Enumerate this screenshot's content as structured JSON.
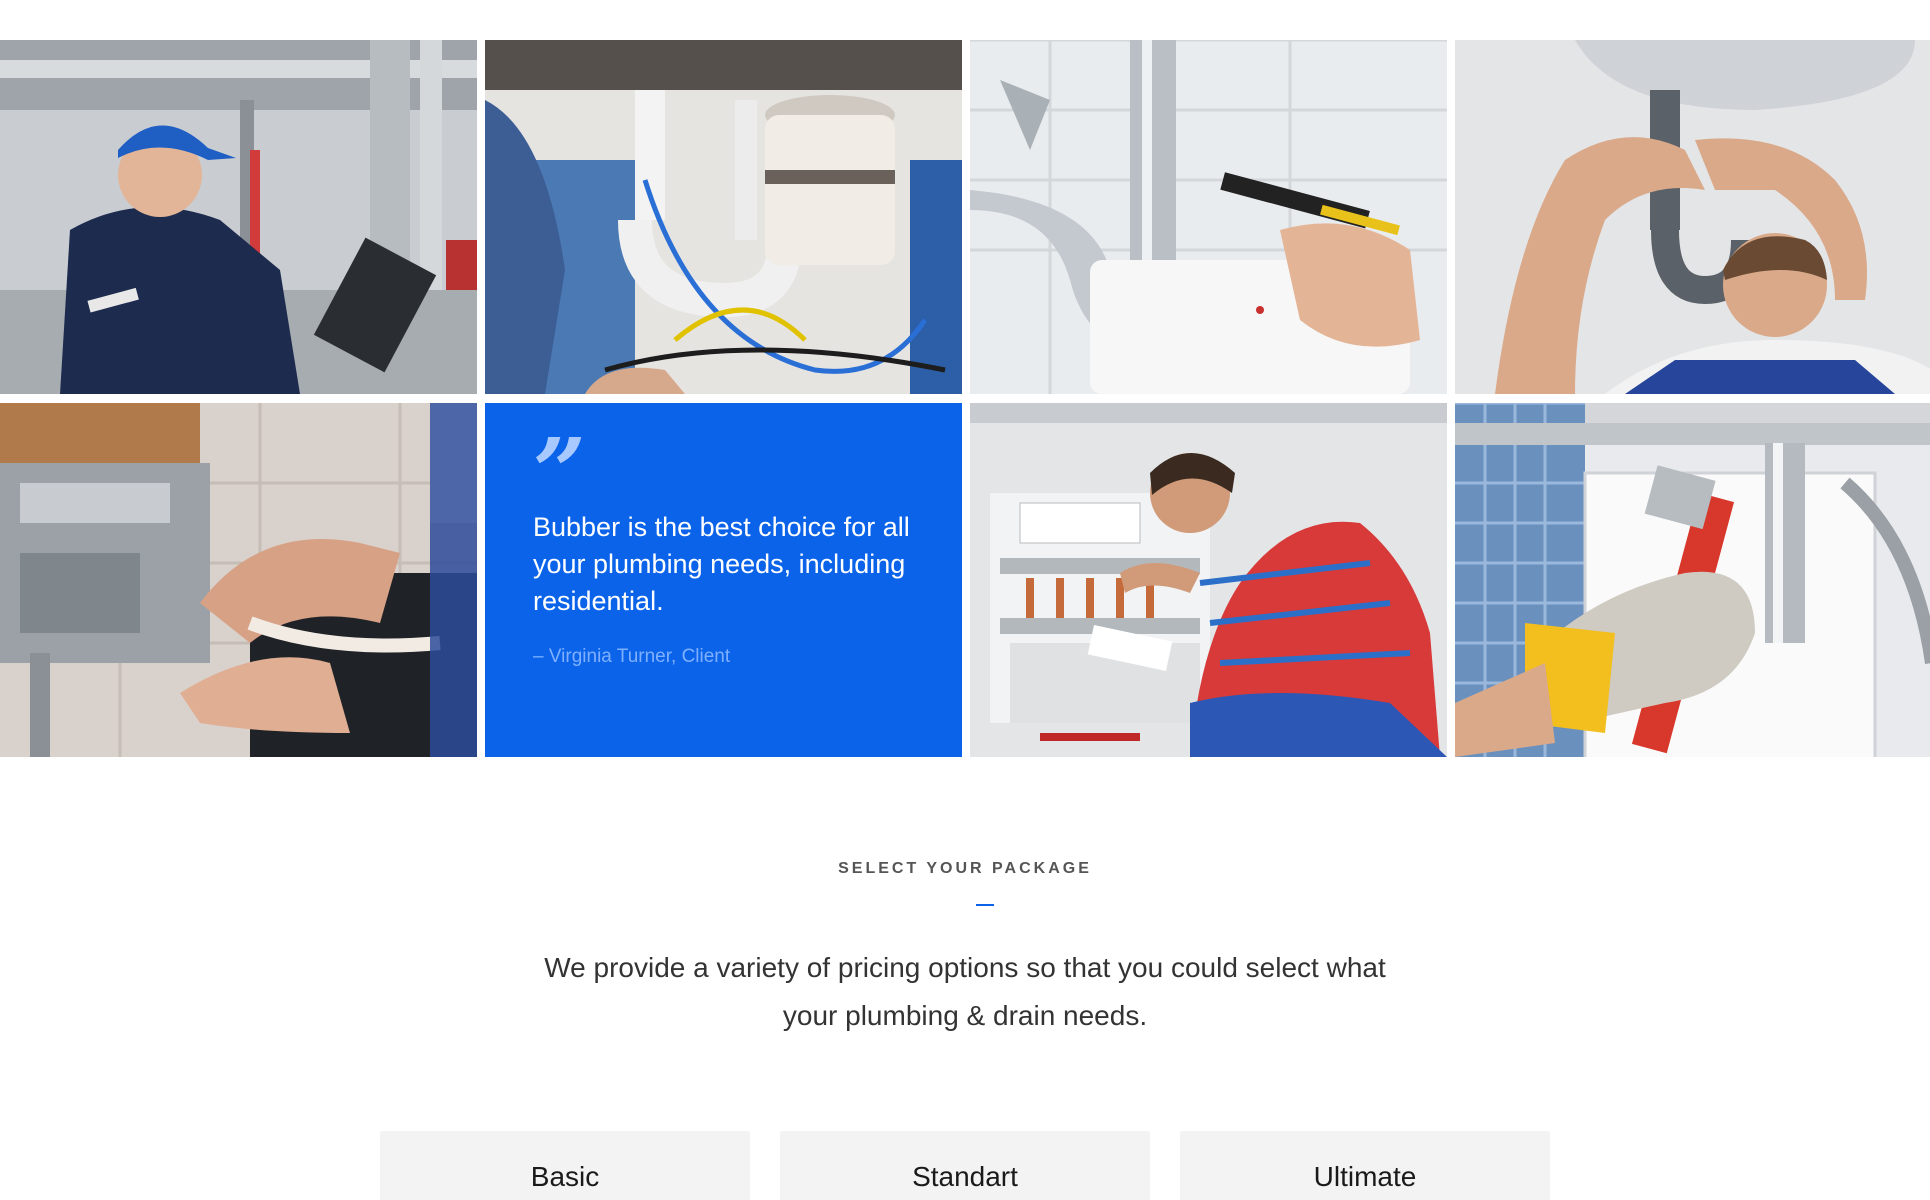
{
  "gallery": {
    "photos": [
      {
        "icon": "technician-clipboard-photo"
      },
      {
        "icon": "sink-pipes-filter-photo"
      },
      {
        "icon": "wrench-chrome-pipe-photo"
      },
      {
        "icon": "plumber-under-sink-photo"
      },
      {
        "icon": "gas-boiler-repair-photo"
      },
      {
        "icon": "manifold-inspection-photo"
      },
      {
        "icon": "pipe-wrench-glove-photo"
      }
    ],
    "quote": {
      "mark": "”",
      "text": "Bubber is the best choice for all your plumbing needs, including residential.",
      "author": "– Virginia Turner, Client",
      "background": "#0a63e9"
    }
  },
  "packages": {
    "eyebrow": "SELECT YOUR PACKAGE",
    "lead": "We provide a variety of pricing options so that you could select what your plumbing & drain needs.",
    "accent": "#0a63e9",
    "plans": [
      {
        "name": "Basic"
      },
      {
        "name": "Standart"
      },
      {
        "name": "Ultimate"
      }
    ]
  }
}
